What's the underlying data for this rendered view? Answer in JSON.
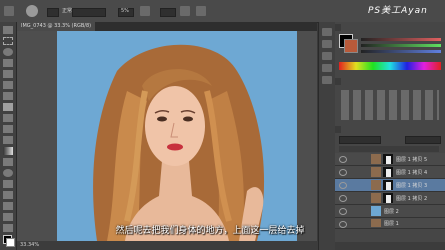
{
  "watermark": "PS美工Ayan",
  "options_bar": {
    "zoom_value": "5%",
    "mode_label": "正常"
  },
  "document": {
    "tab_title": "IMG_0743 @ 33.3% (RGB/8)",
    "status_zoom": "33.34%"
  },
  "subtitle": "然后呢去把我们身体的地方，上面这一层给去掉",
  "layers": [
    {
      "name": "图层 1 拷贝 5",
      "selected": false
    },
    {
      "name": "图层 1 拷贝 4",
      "selected": false
    },
    {
      "name": "图层 1 拷贝 3",
      "selected": true
    },
    {
      "name": "图层 1 拷贝 2",
      "selected": false
    },
    {
      "name": "图层 2",
      "selected": false
    },
    {
      "name": "图层 1",
      "selected": false
    }
  ],
  "colors": {
    "canvas_bg": "#6ea8d3",
    "selected_layer": "#5a7aa0",
    "panel_bg": "#464646"
  }
}
